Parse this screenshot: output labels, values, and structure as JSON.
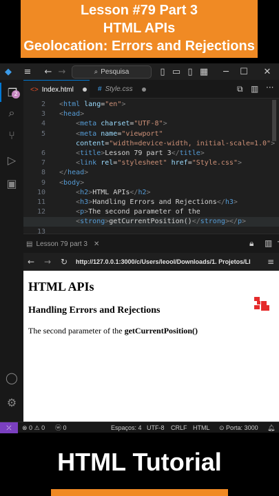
{
  "banner": {
    "line1": "Lesson #79 Part 3",
    "line2": "HTML APIs",
    "line3": "Geolocation: Errors and Rejections"
  },
  "window": {
    "search_label": "Pesquisa",
    "accent": "#0078d4"
  },
  "activity": {
    "badge": "2"
  },
  "tabs": [
    {
      "label": "Index.html"
    },
    {
      "label": "Style.css"
    }
  ],
  "editor": {
    "lines": [
      {
        "n": "2",
        "parts": [
          [
            "t-br",
            "<"
          ],
          [
            "t-tag",
            "html "
          ],
          [
            "t-attr",
            "lang"
          ],
          [
            "t-txt",
            "="
          ],
          [
            "t-str",
            "\"en\""
          ],
          [
            "t-br",
            ">"
          ]
        ]
      },
      {
        "n": "3",
        "parts": [
          [
            "t-br",
            "<"
          ],
          [
            "t-tag",
            "head"
          ],
          [
            "t-br",
            ">"
          ]
        ]
      },
      {
        "n": "4",
        "parts": [
          [
            "t-txt",
            "    "
          ],
          [
            "t-br",
            "<"
          ],
          [
            "t-tag",
            "meta "
          ],
          [
            "t-attr",
            "charset"
          ],
          [
            "t-txt",
            "="
          ],
          [
            "t-str",
            "\"UTF-8\""
          ],
          [
            "t-br",
            ">"
          ]
        ]
      },
      {
        "n": "5",
        "parts": [
          [
            "t-txt",
            "    "
          ],
          [
            "t-br",
            "<"
          ],
          [
            "t-tag",
            "meta "
          ],
          [
            "t-attr",
            "name"
          ],
          [
            "t-txt",
            "="
          ],
          [
            "t-str",
            "\"viewport\""
          ]
        ]
      },
      {
        "n": "",
        "parts": [
          [
            "t-txt",
            "    "
          ],
          [
            "t-attr",
            "content"
          ],
          [
            "t-txt",
            "="
          ],
          [
            "t-str",
            "\"width=device-width, initial-scale=1.0\""
          ],
          [
            "t-br",
            ">"
          ]
        ]
      },
      {
        "n": "6",
        "parts": [
          [
            "t-txt",
            "    "
          ],
          [
            "t-br",
            "<"
          ],
          [
            "t-tag",
            "title"
          ],
          [
            "t-br",
            ">"
          ],
          [
            "t-txt",
            "Lesson 79 part 3"
          ],
          [
            "t-br",
            "</"
          ],
          [
            "t-tag",
            "title"
          ],
          [
            "t-br",
            ">"
          ]
        ]
      },
      {
        "n": "7",
        "parts": [
          [
            "t-txt",
            "    "
          ],
          [
            "t-br",
            "<"
          ],
          [
            "t-tag",
            "link "
          ],
          [
            "t-attr",
            "rel"
          ],
          [
            "t-txt",
            "="
          ],
          [
            "t-str",
            "\"stylesheet\" "
          ],
          [
            "t-attr",
            "href"
          ],
          [
            "t-txt",
            "="
          ],
          [
            "t-str",
            "\"Style.css\""
          ],
          [
            "t-br",
            ">"
          ]
        ]
      },
      {
        "n": "8",
        "parts": [
          [
            "t-br",
            "</"
          ],
          [
            "t-tag",
            "head"
          ],
          [
            "t-br",
            ">"
          ]
        ]
      },
      {
        "n": "9",
        "parts": [
          [
            "t-br",
            "<"
          ],
          [
            "t-tag",
            "body"
          ],
          [
            "t-br",
            ">"
          ]
        ]
      },
      {
        "n": "10",
        "parts": [
          [
            "t-txt",
            "    "
          ],
          [
            "t-br",
            "<"
          ],
          [
            "t-tag",
            "h2"
          ],
          [
            "t-br",
            ">"
          ],
          [
            "t-txt",
            "HTML APIs"
          ],
          [
            "t-br",
            "</"
          ],
          [
            "t-tag",
            "h2"
          ],
          [
            "t-br",
            ">"
          ]
        ]
      },
      {
        "n": "11",
        "parts": [
          [
            "t-txt",
            "    "
          ],
          [
            "t-br",
            "<"
          ],
          [
            "t-tag",
            "h3"
          ],
          [
            "t-br",
            ">"
          ],
          [
            "t-txt",
            "Handling Errors and Rejections"
          ],
          [
            "t-br",
            "</"
          ],
          [
            "t-tag",
            "h3"
          ],
          [
            "t-br",
            ">"
          ]
        ]
      },
      {
        "n": "12",
        "parts": [
          [
            "t-txt",
            "    "
          ],
          [
            "t-br",
            "<"
          ],
          [
            "t-tag",
            "p"
          ],
          [
            "t-br",
            ">"
          ],
          [
            "t-txt",
            "The second parameter of the"
          ]
        ]
      },
      {
        "n": "",
        "parts": [
          [
            "t-txt",
            "    "
          ],
          [
            "t-br",
            "<"
          ],
          [
            "t-tag",
            "strong"
          ],
          [
            "t-br",
            ">"
          ],
          [
            "t-txt",
            "getCurrentPosition()"
          ],
          [
            "t-br",
            "</"
          ],
          [
            "t-tag",
            "strong"
          ],
          [
            "t-br",
            "></"
          ],
          [
            "t-tag",
            "p"
          ],
          [
            "t-br",
            ">"
          ]
        ]
      },
      {
        "n": "13",
        "parts": []
      }
    ]
  },
  "browser": {
    "tab_label": "Lesson 79 part 3",
    "url": "http://127.0.0.1:3000/c/Users/leool/Downloads/1. Projetos/LI",
    "h2": "HTML APIs",
    "h3": "Handling Errors and Rejections",
    "p_text": "The second parameter of the ",
    "p_strong": "getCurrentPosition()"
  },
  "status": {
    "errors": "0",
    "warnings": "0",
    "info": "0",
    "spaces": "Espaços: 4",
    "encoding": "UTF-8",
    "eol": "CRLF",
    "language": "HTML",
    "port": "Porta: 3000"
  },
  "footer": {
    "title": "HTML Tutorial"
  }
}
